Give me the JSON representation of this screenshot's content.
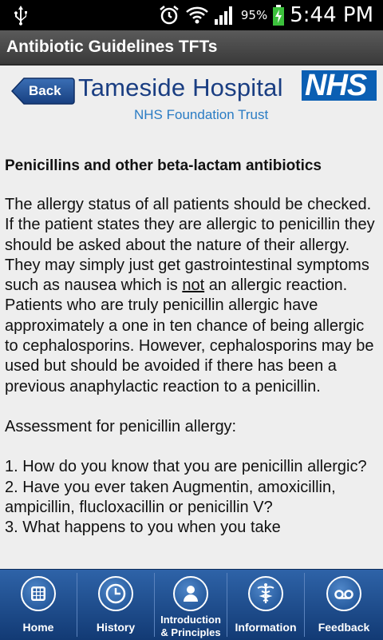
{
  "status_bar": {
    "battery_percent": "95%",
    "time": "5:44 PM"
  },
  "app": {
    "title": "Antibiotic Guidelines TFTs"
  },
  "header": {
    "back_label": "Back",
    "hospital_name": "Tameside Hospital",
    "trust_name": "NHS Foundation Trust",
    "nhs_logo_text": "NHS"
  },
  "content": {
    "heading": "Penicillins and other beta-lactam antibiotics",
    "para1_a": "The allergy status of all patients should be checked. If the patient states they are allergic to penicillin they should be asked about the nature of their allergy. They may simply just get gastrointestinal symptoms such as nausea which is ",
    "para1_underline": "not",
    "para1_b": " an allergic reaction. Patients who are truly penicillin allergic have approximately a one in ten chance of being allergic to cephalosporins. However, cephalosporins may be used but should be avoided if there has been a previous anaphylactic reaction to a penicillin.",
    "assessment_title": "Assessment for penicillin allergy:",
    "q1": "1. How do you know that you are penicillin allergic?",
    "q2": "2. Have you ever taken Augmentin, amoxicillin, ampicillin, flucloxacillin or penicillin V?",
    "q3": "3. What happens to you when you take"
  },
  "tabs": [
    {
      "label": "Home",
      "icon": "grid-icon"
    },
    {
      "label": "History",
      "icon": "clock-icon"
    },
    {
      "label_line1": "Introduction",
      "label_line2": "& Principles",
      "icon": "person-icon"
    },
    {
      "label": "Information",
      "icon": "caduceus-icon"
    },
    {
      "label": "Feedback",
      "icon": "voicemail-icon"
    }
  ],
  "colors": {
    "hospital_blue": "#1a3e82",
    "nhs_blue": "#0b5fb3",
    "tabbar_blue": "#2e63a8"
  }
}
